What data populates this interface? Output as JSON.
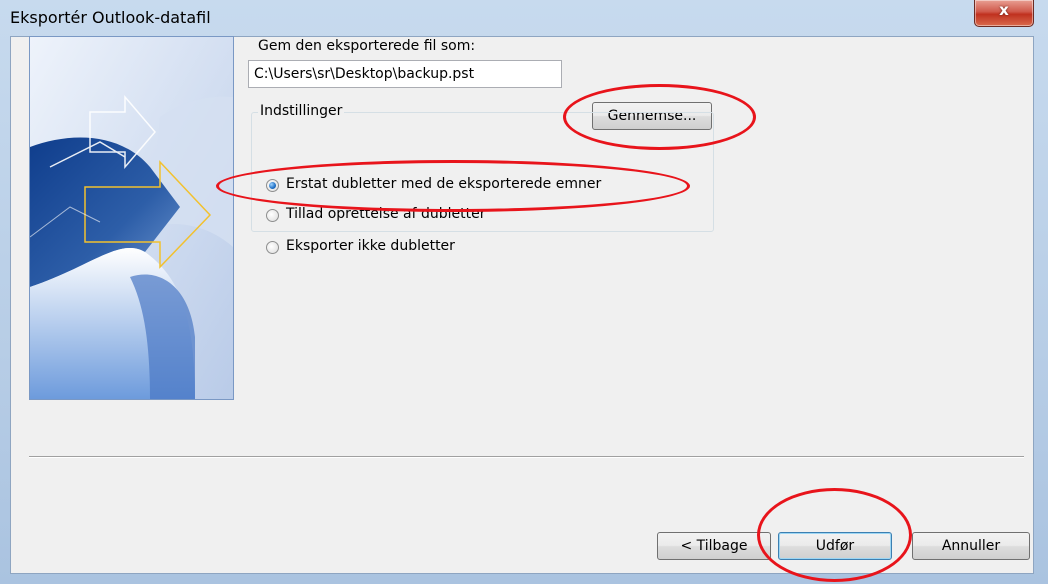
{
  "window": {
    "title": "Eksportér Outlook-datafil",
    "close_symbol": "x"
  },
  "save_as": {
    "label": "Gem den eksporterede fil som:",
    "path_value": "C:\\Users\\sr\\Desktop\\backup.pst",
    "browse_label": "Gennemse..."
  },
  "options": {
    "legend": "Indstillinger",
    "items": [
      {
        "label": "Erstat dubletter med de eksporterede emner",
        "checked": true
      },
      {
        "label": "Tillad oprettelse af dubletter",
        "checked": false
      },
      {
        "label": "Eksporter ikke dubletter",
        "checked": false
      }
    ]
  },
  "footer": {
    "back_label": "< Tilbage",
    "finish_label": "Udfør",
    "cancel_label": "Annuller"
  },
  "colors": {
    "annotation": "#e8141b",
    "banner_blue": "#2d5ea8",
    "banner_arrow": "#f2c12e"
  },
  "icons": [
    "close-icon",
    "export-wizard-graphic"
  ]
}
